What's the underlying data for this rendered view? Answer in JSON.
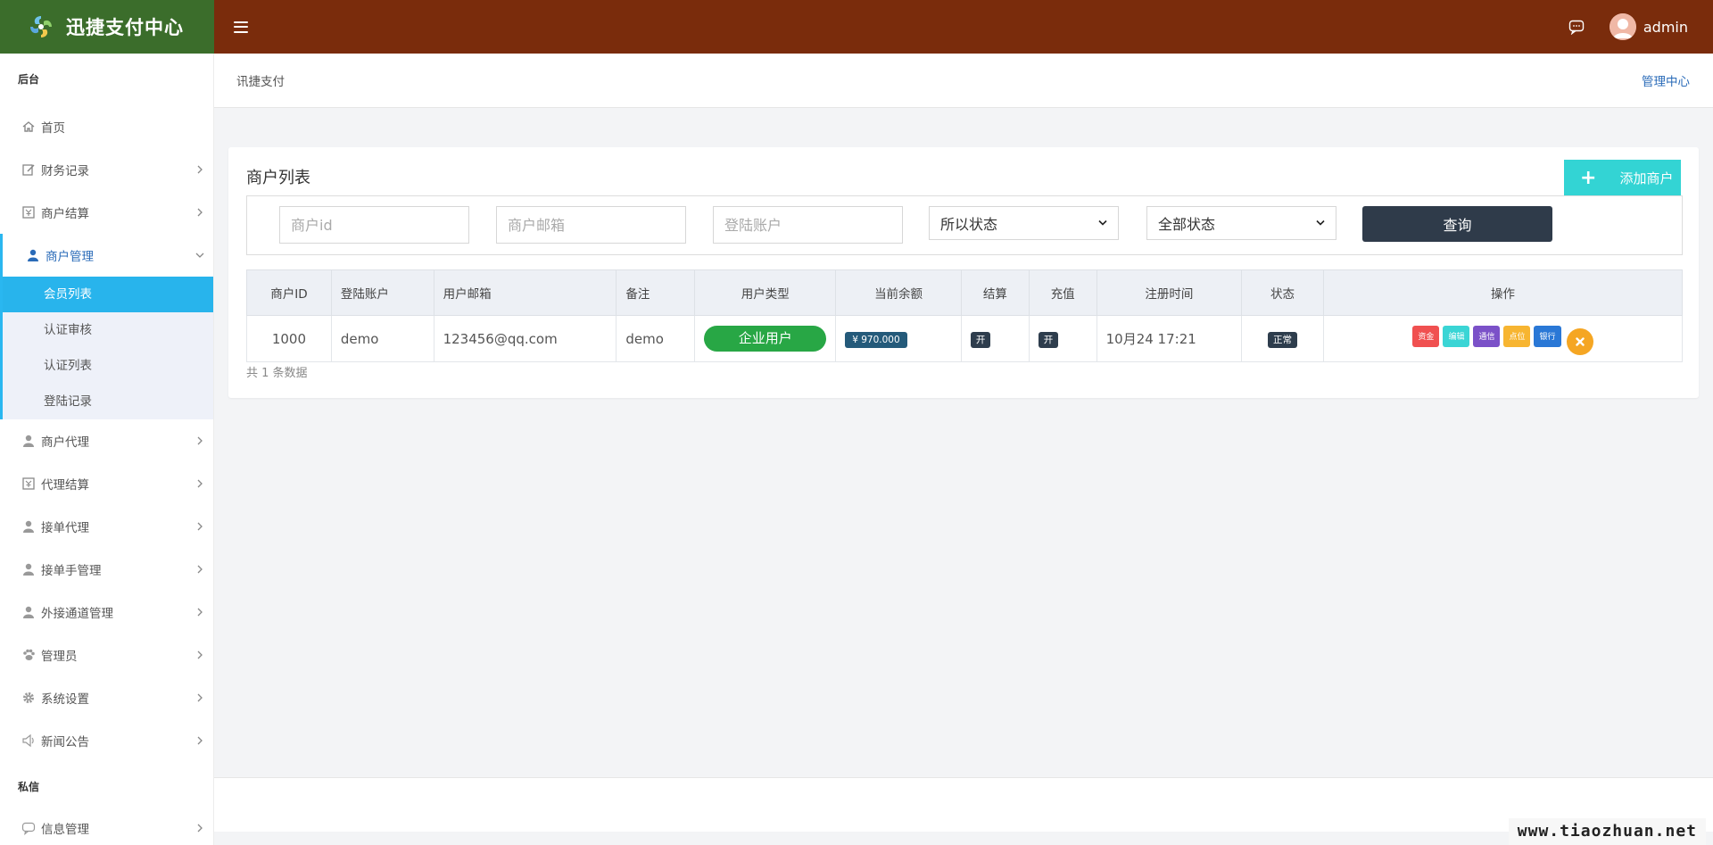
{
  "brand": {
    "name": "迅捷支付中心"
  },
  "header": {
    "user_name": "admin"
  },
  "sidebar": {
    "section_main": "后台",
    "items": [
      {
        "label": "首页",
        "icon": "home-icon"
      },
      {
        "label": "财务记录",
        "icon": "edit-icon"
      },
      {
        "label": "商户结算",
        "icon": "bill-icon"
      },
      {
        "label": "商户管理",
        "icon": "user-icon",
        "open": true,
        "children": [
          {
            "label": "会员列表",
            "active": true
          },
          {
            "label": "认证审核"
          },
          {
            "label": "认证列表"
          },
          {
            "label": "登陆记录"
          }
        ]
      },
      {
        "label": "商户代理",
        "icon": "user-icon"
      },
      {
        "label": "代理结算",
        "icon": "bill-icon"
      },
      {
        "label": "接单代理",
        "icon": "user-icon"
      },
      {
        "label": "接单手管理",
        "icon": "user-icon"
      },
      {
        "label": "外接通道管理",
        "icon": "user-icon"
      },
      {
        "label": "管理员",
        "icon": "paw-icon"
      },
      {
        "label": "系统设置",
        "icon": "gear-icon"
      },
      {
        "label": "新闻公告",
        "icon": "speaker-icon"
      }
    ],
    "section_private": "私信",
    "private_items": [
      {
        "label": "信息管理",
        "icon": "message-icon"
      }
    ]
  },
  "breadcrumb": {
    "left": "讯捷支付",
    "right": "管理中心"
  },
  "panel": {
    "title": "商户列表",
    "add_button": "添加商户",
    "filters": {
      "merchant_id_placeholder": "商户id",
      "email_placeholder": "商户邮箱",
      "account_placeholder": "登陆账户",
      "status_select": "所以状态",
      "all_status_select": "全部状态",
      "query_button": "查询"
    },
    "table": {
      "headers": [
        "商户ID",
        "登陆账户",
        "用户邮箱",
        "备注",
        "用户类型",
        "当前余额",
        "结算",
        "充值",
        "注册时间",
        "状态",
        "操作"
      ],
      "rows": [
        {
          "id": "1000",
          "account": "demo",
          "email": "123456@qq.com",
          "note": "demo",
          "type": "企业用户",
          "balance": "¥ 970.000",
          "settle": "开",
          "recharge": "开",
          "reg_time": "10月24 17:21",
          "status": "正常",
          "ops": [
            "资金",
            "编辑",
            "通信",
            "点位",
            "银行"
          ]
        }
      ]
    },
    "total": "共 1 条数据"
  },
  "watermark": "www.tiaozhuan.net",
  "colors": {
    "brand_bg": "#3b6d2b",
    "topnav_bg": "#7a2c0c",
    "sidebar_active": "#28b4ec",
    "add_button": "#33d4d4",
    "query_button": "#2f3b4a",
    "type_pill": "#28a745",
    "op_funds": "#f05050",
    "op_edit": "#3ad5d5",
    "op_comm": "#7b51c8",
    "op_point": "#f7b531",
    "op_bank": "#2a78d6",
    "op_delete": "#f5a623"
  }
}
